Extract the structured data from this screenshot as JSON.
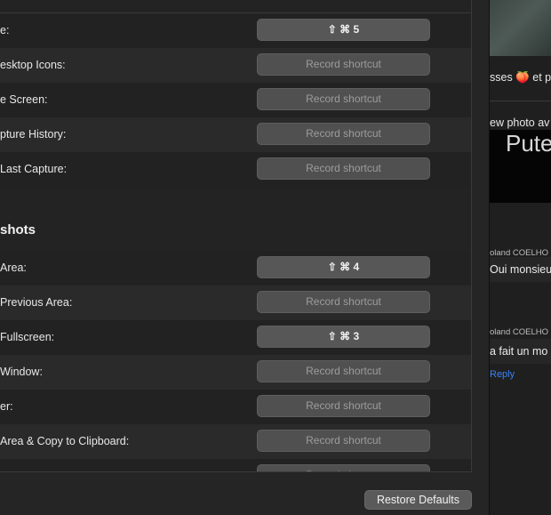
{
  "settings": {
    "rows_top": [
      {
        "label": "e:",
        "shortcut": "⇧ ⌘ 5",
        "is_set": true
      },
      {
        "label": "esktop Icons:",
        "shortcut": "Record shortcut",
        "is_set": false
      },
      {
        "label": "e Screen:",
        "shortcut": "Record shortcut",
        "is_set": false
      },
      {
        "label": "pture History:",
        "shortcut": "Record shortcut",
        "is_set": false
      },
      {
        "label": "Last Capture:",
        "shortcut": "Record shortcut",
        "is_set": false
      }
    ],
    "section_title": "shots",
    "rows_bottom": [
      {
        "label": "Area:",
        "shortcut": "⇧ ⌘ 4",
        "is_set": true
      },
      {
        "label": "Previous Area:",
        "shortcut": "Record shortcut",
        "is_set": false
      },
      {
        "label": "Fullscreen:",
        "shortcut": "⇧ ⌘ 3",
        "is_set": true
      },
      {
        "label": "Window:",
        "shortcut": "Record shortcut",
        "is_set": false
      },
      {
        "label": "er:",
        "shortcut": "Record shortcut",
        "is_set": false
      },
      {
        "label": "Area & Copy to Clipboard:",
        "shortcut": "Record shortcut",
        "is_set": false
      },
      {
        "label": "",
        "shortcut": "Record shortcut",
        "is_set": false
      }
    ],
    "restore_label": "Restore Defaults"
  },
  "chat": {
    "line1_text": "sses",
    "line1_emoji": "🍑",
    "line1_tail": "et p",
    "line2_text": "ew photo av",
    "image_text": "Pute",
    "messages": [
      {
        "author": "oland COELHO",
        "text": "Oui monsieur"
      },
      {
        "author": "oland COELHO",
        "text": "a fait un mo"
      }
    ],
    "reply_label": "Reply"
  }
}
